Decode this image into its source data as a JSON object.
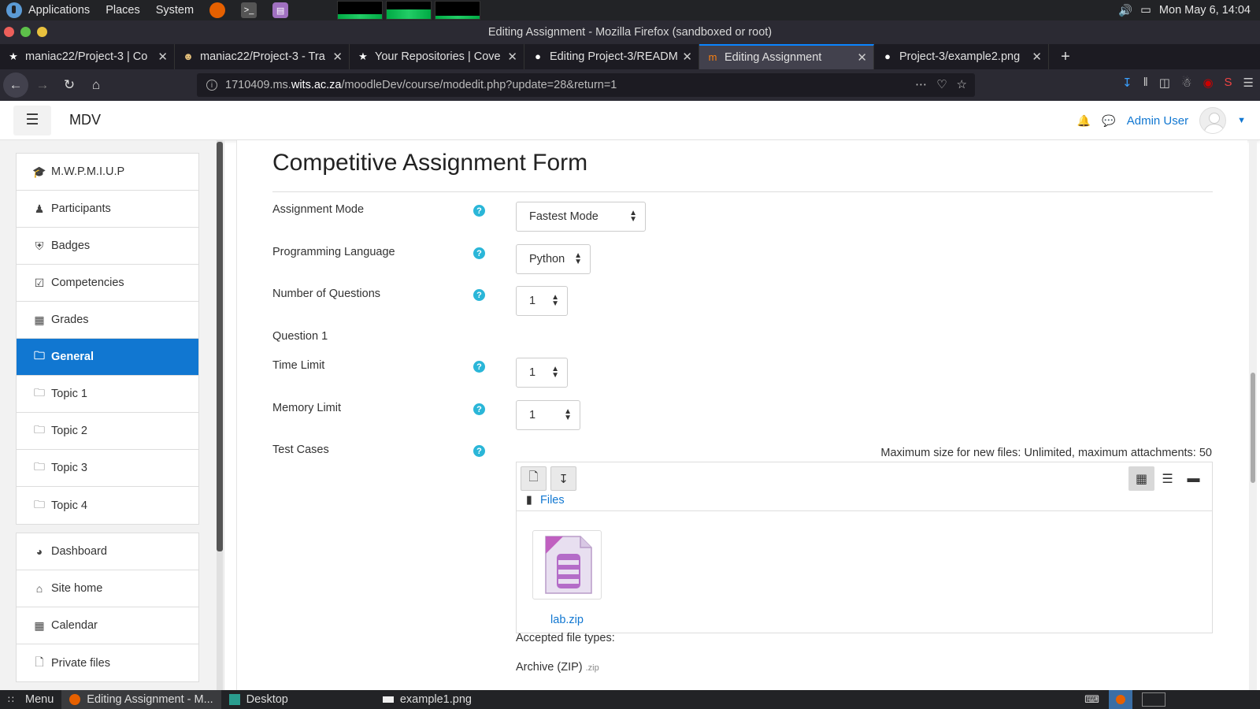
{
  "gnome": {
    "menu": [
      "Applications",
      "Places",
      "System"
    ],
    "clock": "Mon May 6, 14:04"
  },
  "window": {
    "title": "Editing Assignment - Mozilla Firefox (sandboxed or root)"
  },
  "tabs": [
    {
      "label": "maniac22/Project-3 | Co",
      "icon": "star-icon"
    },
    {
      "label": "maniac22/Project-3 - Tra",
      "icon": "travis-icon"
    },
    {
      "label": "Your Repositories | Cove",
      "icon": "star-icon"
    },
    {
      "label": "Editing Project-3/READM",
      "icon": "github-icon"
    },
    {
      "label": "Editing Assignment",
      "icon": "moodle-icon",
      "active": true
    },
    {
      "label": "Project-3/example2.png",
      "icon": "github-icon"
    }
  ],
  "browser": {
    "url_prefix": "1710409.ms.",
    "url_domain": "wits.ac.za",
    "url_rest": "/moodleDev/course/modedit.php?update=28&return=1",
    "download_badge": "0"
  },
  "header": {
    "site_name": "MDV",
    "user_name": "Admin User"
  },
  "sidebar": {
    "group1": [
      {
        "label": "M.W.P.M.I.U.P",
        "icon": "graduation-cap-icon"
      },
      {
        "label": "Participants",
        "icon": "users-icon"
      },
      {
        "label": "Badges",
        "icon": "shield-icon"
      },
      {
        "label": "Competencies",
        "icon": "check-square-icon"
      },
      {
        "label": "Grades",
        "icon": "table-icon"
      },
      {
        "label": "General",
        "icon": "folder-icon",
        "active": true
      },
      {
        "label": "Topic 1",
        "icon": "folder-icon"
      },
      {
        "label": "Topic 2",
        "icon": "folder-icon"
      },
      {
        "label": "Topic 3",
        "icon": "folder-icon"
      },
      {
        "label": "Topic 4",
        "icon": "folder-icon"
      }
    ],
    "group2": [
      {
        "label": "Dashboard",
        "icon": "tachometer-icon"
      },
      {
        "label": "Site home",
        "icon": "home-icon"
      },
      {
        "label": "Calendar",
        "icon": "calendar-icon"
      },
      {
        "label": "Private files",
        "icon": "file-icon"
      }
    ]
  },
  "form": {
    "title": "Competitive Assignment Form",
    "assignment_mode": {
      "label": "Assignment Mode",
      "value": "Fastest Mode"
    },
    "programming_language": {
      "label": "Programming Language",
      "value": "Python"
    },
    "num_questions": {
      "label": "Number of Questions",
      "value": "1"
    },
    "question_heading": "Question 1",
    "time_limit": {
      "label": "Time Limit",
      "value": "1"
    },
    "memory_limit": {
      "label": "Memory Limit",
      "value": "1"
    },
    "test_cases": {
      "label": "Test Cases"
    },
    "file_info": "Maximum size for new files: Unlimited, maximum attachments: 50",
    "files_path": "Files",
    "file_name": "lab.zip",
    "accepted_label": "Accepted file types:",
    "accepted_type": "Archive (ZIP)",
    "accepted_ext": ".zip"
  },
  "taskbar": {
    "menu": "Menu",
    "items": [
      {
        "label": "Editing Assignment - M...",
        "active": true
      },
      {
        "label": "Desktop"
      },
      {
        "label": "example1.png"
      }
    ]
  },
  "colors": {
    "accent": "#1177d1",
    "help": "#2ab6d8",
    "firefox_tab_active": "#42414d"
  }
}
